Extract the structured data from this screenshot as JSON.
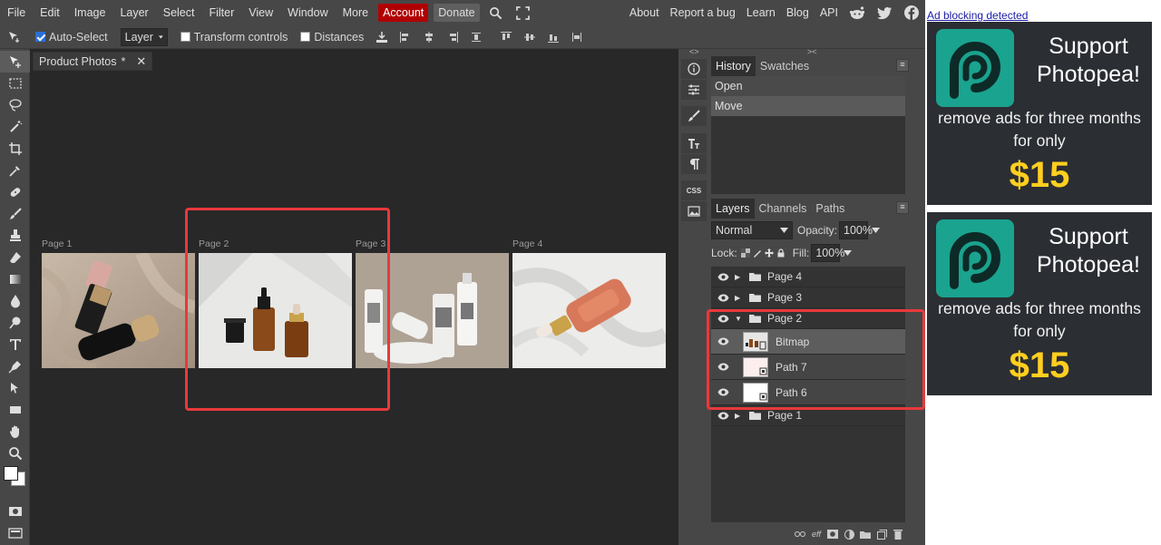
{
  "menubar": {
    "items": [
      "File",
      "Edit",
      "Image",
      "Layer",
      "Select",
      "Filter",
      "View",
      "Window",
      "More"
    ],
    "account": "Account",
    "donate": "Donate",
    "right_links": [
      "About",
      "Report a bug",
      "Learn",
      "Blog",
      "API"
    ],
    "icons": [
      "search-icon",
      "fullscreen-icon",
      "reddit-icon",
      "twitter-icon",
      "facebook-icon"
    ]
  },
  "options": {
    "auto_select": "Auto-Select",
    "auto_select_checked": true,
    "target": "Layer",
    "transform_controls": "Transform controls",
    "distances": "Distances"
  },
  "document": {
    "tab_title": "Product Photos",
    "tab_modified": "*",
    "pages": [
      {
        "label": "Page 1"
      },
      {
        "label": "Page 2"
      },
      {
        "label": "Page 3"
      },
      {
        "label": "Page 4"
      }
    ]
  },
  "iconcol": {
    "css_label": "CSS",
    "collapse_left": "<>",
    "collapse_right": "><"
  },
  "history": {
    "tabs": [
      "History",
      "Swatches"
    ],
    "rows": [
      "Open",
      "Move"
    ],
    "menu_glyph": "≡"
  },
  "layers": {
    "tabs": [
      "Layers",
      "Channels",
      "Paths"
    ],
    "blend_mode": "Normal",
    "opacity_label": "Opacity:",
    "opacity": "100%",
    "lock_label": "Lock:",
    "fill_label": "Fill:",
    "fill": "100%",
    "groups": [
      {
        "name": "Page 4",
        "expanded": false
      },
      {
        "name": "Page 3",
        "expanded": false
      },
      {
        "name": "Page 2",
        "expanded": true
      },
      {
        "name": "Page 1",
        "expanded": false
      }
    ],
    "children": [
      {
        "name": "Bitmap",
        "selected": true
      },
      {
        "name": "Path 7",
        "selected": false
      },
      {
        "name": "Path 6",
        "selected": false
      }
    ],
    "footer_icons": [
      "link-icon",
      "effects-icon",
      "mask-icon",
      "adjustment-icon",
      "folder-icon",
      "new-layer-icon",
      "delete-icon"
    ],
    "footer_eff": "eff"
  },
  "ads": {
    "notice": "Ad blocking detected",
    "support_line1": "Support",
    "support_line2": "Photopea!",
    "sub_line1": "remove ads for three months",
    "sub_line2": "for only",
    "price": "$15"
  },
  "colors": {
    "highlight": "#e8393c",
    "account_bg": "#b10000",
    "ad_bg": "#2b2e33",
    "ad_accent": "#1aa38f",
    "ad_price": "#ffcf1f"
  }
}
